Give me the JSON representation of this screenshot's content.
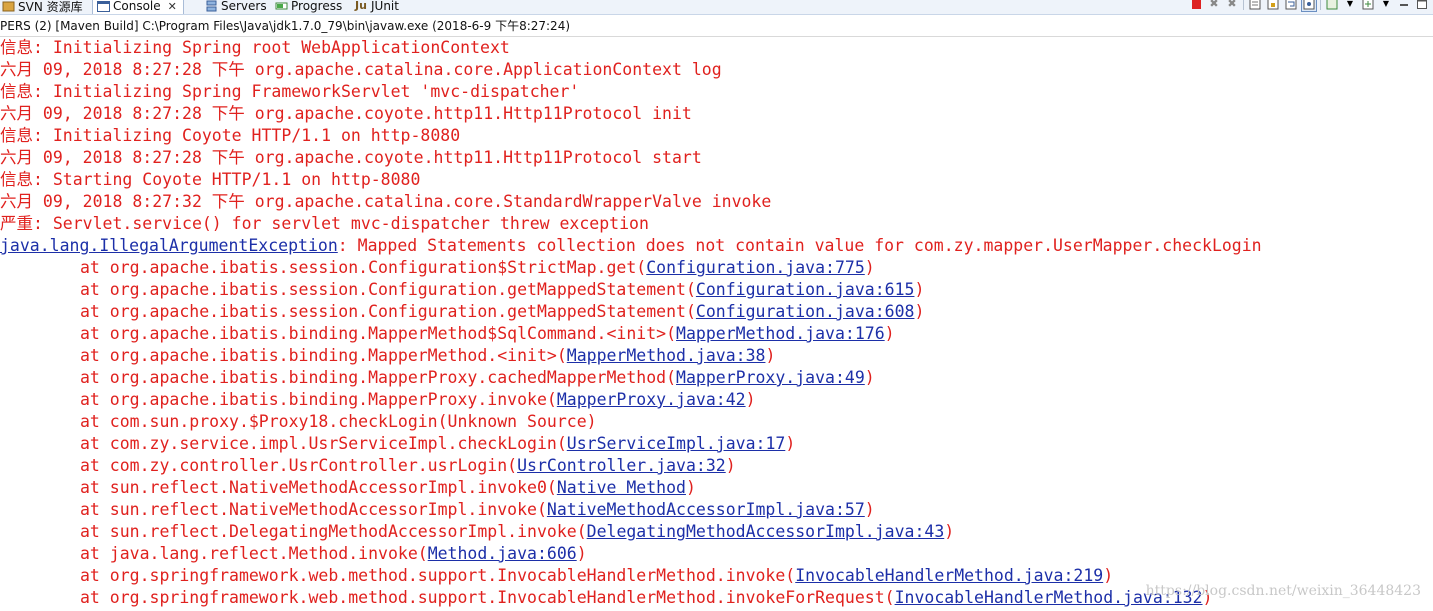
{
  "tabs": [
    {
      "label": "SVN 资源库",
      "icon": "svn-repository-icon"
    },
    {
      "label": "Console",
      "icon": "console-icon",
      "active": true
    },
    {
      "label": "Servers",
      "icon": "servers-icon"
    },
    {
      "label": "Progress",
      "icon": "progress-icon"
    },
    {
      "label": "JUnit",
      "icon": "junit-icon"
    }
  ],
  "launch_description": "PERS (2) [Maven Build] C:\\Program Files\\Java\\jdk1.7.0_79\\bin\\javaw.exe (2018-6-9 下午8:27:24)",
  "toolbar_icons": [
    "terminate-icon",
    "remove-launch-icon",
    "remove-all-terminated-icon",
    "clear-console-icon",
    "scroll-lock-icon",
    "word-wrap-icon",
    "pin-console-icon",
    "display-selected-console-icon",
    "open-console-icon",
    "minimize-icon",
    "maximize-icon"
  ],
  "console": {
    "log_lines": [
      "信息: Initializing Spring root WebApplicationContext",
      "六月 09, 2018 8:27:28 下午 org.apache.catalina.core.ApplicationContext log",
      "信息: Initializing Spring FrameworkServlet 'mvc-dispatcher'",
      "六月 09, 2018 8:27:28 下午 org.apache.coyote.http11.Http11Protocol init",
      "信息: Initializing Coyote HTTP/1.1 on http-8080",
      "六月 09, 2018 8:27:28 下午 org.apache.coyote.http11.Http11Protocol start",
      "信息: Starting Coyote HTTP/1.1 on http-8080",
      "六月 09, 2018 8:27:32 下午 org.apache.catalina.core.StandardWrapperValve invoke",
      "严重: Servlet.service() for servlet mvc-dispatcher threw exception"
    ],
    "exception": {
      "type": "java.lang.IllegalArgumentException",
      "message": ": Mapped Statements collection does not contain value for com.zy.mapper.UserMapper.checkLogin"
    },
    "stack": [
      {
        "method": "at org.apache.ibatis.session.Configuration$StrictMap.get(",
        "source": "Configuration.java:775",
        "close": ")"
      },
      {
        "method": "at org.apache.ibatis.session.Configuration.getMappedStatement(",
        "source": "Configuration.java:615",
        "close": ")"
      },
      {
        "method": "at org.apache.ibatis.session.Configuration.getMappedStatement(",
        "source": "Configuration.java:608",
        "close": ")"
      },
      {
        "method": "at org.apache.ibatis.binding.MapperMethod$SqlCommand.<init>(",
        "source": "MapperMethod.java:176",
        "close": ")"
      },
      {
        "method": "at org.apache.ibatis.binding.MapperMethod.<init>(",
        "source": "MapperMethod.java:38",
        "close": ")"
      },
      {
        "method": "at org.apache.ibatis.binding.MapperProxy.cachedMapperMethod(",
        "source": "MapperProxy.java:49",
        "close": ")"
      },
      {
        "method": "at org.apache.ibatis.binding.MapperProxy.invoke(",
        "source": "MapperProxy.java:42",
        "close": ")"
      },
      {
        "method": "at com.sun.proxy.$Proxy18.checkLogin(Unknown Source)",
        "source": "",
        "close": ""
      },
      {
        "method": "at com.zy.service.impl.UsrServiceImpl.checkLogin(",
        "source": "UsrServiceImpl.java:17",
        "close": ")"
      },
      {
        "method": "at com.zy.controller.UsrController.usrLogin(",
        "source": "UsrController.java:32",
        "close": ")"
      },
      {
        "method": "at sun.reflect.NativeMethodAccessorImpl.invoke0(",
        "source": "Native Method",
        "close": ")"
      },
      {
        "method": "at sun.reflect.NativeMethodAccessorImpl.invoke(",
        "source": "NativeMethodAccessorImpl.java:57",
        "close": ")"
      },
      {
        "method": "at sun.reflect.DelegatingMethodAccessorImpl.invoke(",
        "source": "DelegatingMethodAccessorImpl.java:43",
        "close": ")"
      },
      {
        "method": "at java.lang.reflect.Method.invoke(",
        "source": "Method.java:606",
        "close": ")"
      },
      {
        "method": "at org.springframework.web.method.support.InvocableHandlerMethod.invoke(",
        "source": "InvocableHandlerMethod.java:219",
        "close": ")"
      },
      {
        "method": "at org.springframework.web.method.support.InvocableHandlerMethod.invokeForRequest(",
        "source": "InvocableHandlerMethod.java:132",
        "close": ")"
      }
    ]
  },
  "watermark": "https://blog.csdn.net/weixin_36448423",
  "colors": {
    "error_text": "#e0211e",
    "link": "#1c2fa8"
  }
}
